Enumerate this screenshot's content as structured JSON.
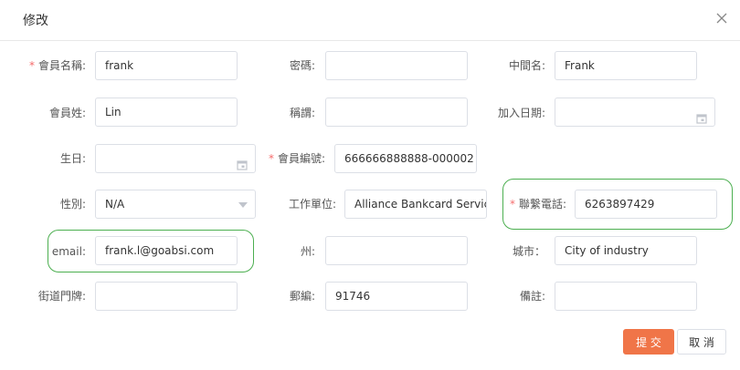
{
  "dialog": {
    "title": "修改"
  },
  "fields": {
    "member_name": {
      "label": "會員名稱:",
      "value": "frank"
    },
    "password": {
      "label": "密碼:",
      "value": ""
    },
    "middle_name": {
      "label": "中間名:",
      "value": "Frank"
    },
    "surname": {
      "label": "會員姓:",
      "value": "Lin"
    },
    "title": {
      "label": "稱謂:",
      "value": ""
    },
    "join_date": {
      "label": "加入日期:",
      "value": ""
    },
    "birthday": {
      "label": "生日:",
      "value": ""
    },
    "member_id": {
      "label": "會員編號:",
      "value": "666666888888-000002"
    },
    "gender": {
      "label": "性別:",
      "value": "N/A"
    },
    "employer": {
      "label": "工作單位:",
      "value": "Alliance Bankcard Services"
    },
    "phone": {
      "label": "聯繫電話:",
      "value": "6263897429"
    },
    "email": {
      "label": "email:",
      "value": "frank.l@goabsi.com"
    },
    "state": {
      "label": "州:",
      "value": ""
    },
    "city": {
      "label": "城市：",
      "value": "City of industry"
    },
    "street": {
      "label": "街道門牌:",
      "value": ""
    },
    "zip": {
      "label": "郵編:",
      "value": "91746"
    },
    "notes": {
      "label": "備註:",
      "value": ""
    }
  },
  "required_mark": "*",
  "buttons": {
    "submit": "提 交",
    "cancel": "取 消"
  },
  "colors": {
    "required": "#f56c6c",
    "submit": "#f07548",
    "highlight": "#4caf50"
  },
  "icons": {
    "close": "close-icon",
    "calendar": "calendar-icon",
    "dropdown": "chevron-down-icon"
  }
}
